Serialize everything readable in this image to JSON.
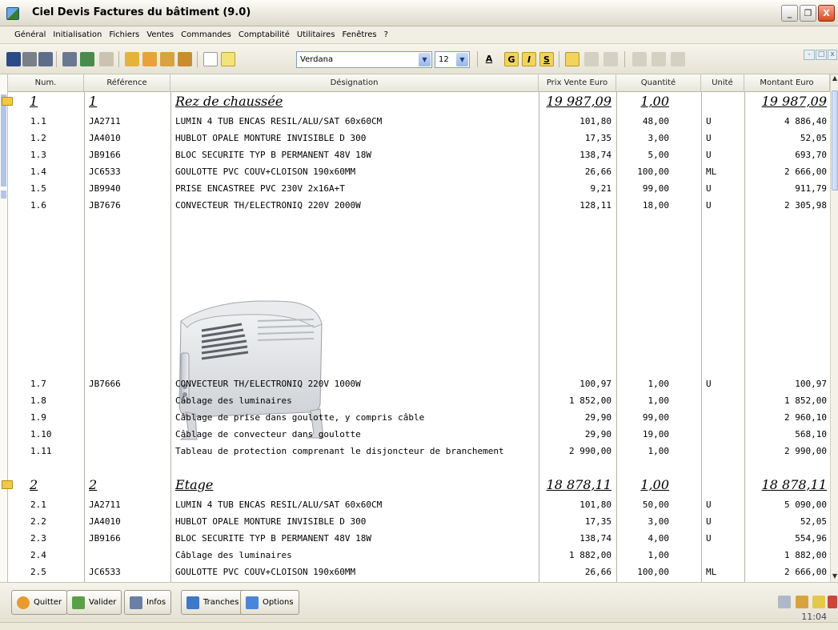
{
  "window": {
    "title": "Ciel Devis Factures du bâtiment (9.0)",
    "buttons": {
      "minimize": "_",
      "restore": "❐",
      "close": "X"
    }
  },
  "menu": [
    "Général",
    "Initialisation",
    "Fichiers",
    "Ventes",
    "Commandes",
    "Comptabilité",
    "Utilitaires",
    "Fenêtres",
    "?"
  ],
  "toolbar": {
    "font": "Verdana",
    "size": "12",
    "bold": "G",
    "italic": "I",
    "underline": "S",
    "color_letter": "A"
  },
  "columns": {
    "num": "Num.",
    "ref": "Référence",
    "des": "Désignation",
    "prix": "Prix Vente Euro",
    "qte": "Quantité",
    "unite": "Unité",
    "montant": "Montant Euro"
  },
  "section1": {
    "num": "1",
    "ref": "1",
    "des": "Rez de chaussée",
    "prix": "19 987,09",
    "qte": "1,00",
    "montant": "19 987,09"
  },
  "rows1": [
    {
      "num": "1.1",
      "ref": "JA2711",
      "des": "LUMIN 4 TUB ENCAS RESIL/ALU/SAT 60x60CM",
      "prix": "101,80",
      "qte": "48,00",
      "unite": "U",
      "montant": "4 886,40"
    },
    {
      "num": "1.2",
      "ref": "JA4010",
      "des": "HUBLOT OPALE MONTURE INVISIBLE D 300",
      "prix": "17,35",
      "qte": "3,00",
      "unite": "U",
      "montant": "52,05"
    },
    {
      "num": "1.3",
      "ref": "JB9166",
      "des": "BLOC SECURITE TYP B PERMANENT 48V 18W",
      "prix": "138,74",
      "qte": "5,00",
      "unite": "U",
      "montant": "693,70"
    },
    {
      "num": "1.4",
      "ref": "JC6533",
      "des": "GOULOTTE PVC COUV+CLOISON 190x60MM",
      "prix": "26,66",
      "qte": "100,00",
      "unite": "ML",
      "montant": "2 666,00"
    },
    {
      "num": "1.5",
      "ref": "JB9940",
      "des": "PRISE ENCASTREE PVC 230V 2x16A+T",
      "prix": "9,21",
      "qte": "99,00",
      "unite": "U",
      "montant": "911,79"
    },
    {
      "num": "1.6",
      "ref": "JB7676",
      "des": "CONVECTEUR TH/ELECTRONIQ 220V 2000W",
      "prix": "128,11",
      "qte": "18,00",
      "unite": "U",
      "montant": "2 305,98"
    }
  ],
  "rows1b": [
    {
      "num": "1.7",
      "ref": "JB7666",
      "des": "CONVECTEUR TH/ELECTRONIQ 220V 1000W",
      "prix": "100,97",
      "qte": "1,00",
      "unite": "U",
      "montant": "100,97"
    },
    {
      "num": "1.8",
      "ref": "",
      "des": "Câblage des luminaires",
      "prix": "1 852,00",
      "qte": "1,00",
      "unite": "",
      "montant": "1 852,00"
    },
    {
      "num": "1.9",
      "ref": "",
      "des": "Câblage de prise dans goulotte, y compris câble",
      "prix": "29,90",
      "qte": "99,00",
      "unite": "",
      "montant": "2 960,10"
    },
    {
      "num": "1.10",
      "ref": "",
      "des": "Câblage de convecteur dans goulotte",
      "prix": "29,90",
      "qte": "19,00",
      "unite": "",
      "montant": "568,10"
    },
    {
      "num": "1.11",
      "ref": "",
      "des": "Tableau de protection comprenant le disjoncteur de branchement",
      "prix": "2 990,00",
      "qte": "1,00",
      "unite": "",
      "montant": "2 990,00"
    }
  ],
  "section2": {
    "num": "2",
    "ref": "2",
    "des": "Etage",
    "prix": "18 878,11",
    "qte": "1,00",
    "montant": "18 878,11"
  },
  "rows2": [
    {
      "num": "2.1",
      "ref": "JA2711",
      "des": "LUMIN 4 TUB ENCAS RESIL/ALU/SAT 60x60CM",
      "prix": "101,80",
      "qte": "50,00",
      "unite": "U",
      "montant": "5 090,00"
    },
    {
      "num": "2.2",
      "ref": "JA4010",
      "des": "HUBLOT OPALE MONTURE INVISIBLE D 300",
      "prix": "17,35",
      "qte": "3,00",
      "unite": "U",
      "montant": "52,05"
    },
    {
      "num": "2.3",
      "ref": "JB9166",
      "des": "BLOC SECURITE TYP B PERMANENT 48V 18W",
      "prix": "138,74",
      "qte": "4,00",
      "unite": "U",
      "montant": "554,96"
    },
    {
      "num": "2.4",
      "ref": "",
      "des": "Câblage des luminaires",
      "prix": "1 882,00",
      "qte": "1,00",
      "unite": "",
      "montant": "1 882,00"
    },
    {
      "num": "2.5",
      "ref": "JC6533",
      "des": "GOULOTTE PVC COUV+CLOISON 190x60MM",
      "prix": "26,66",
      "qte": "100,00",
      "unite": "ML",
      "montant": "2 666,00"
    }
  ],
  "buttons": {
    "quitter": "Quitter",
    "valider": "Valider",
    "infos": "Infos",
    "tranches": "Tranches",
    "options": "Options"
  },
  "status": {
    "clock": "11:04"
  },
  "icons": {
    "app": "ciel-logo-icon",
    "folder": "folder-icon",
    "heater_image": "convector-heater-image"
  },
  "colors": {
    "title_bar": "#ece9d8",
    "selection_mark": "#adc6ea",
    "close_button": "#d9481d"
  }
}
